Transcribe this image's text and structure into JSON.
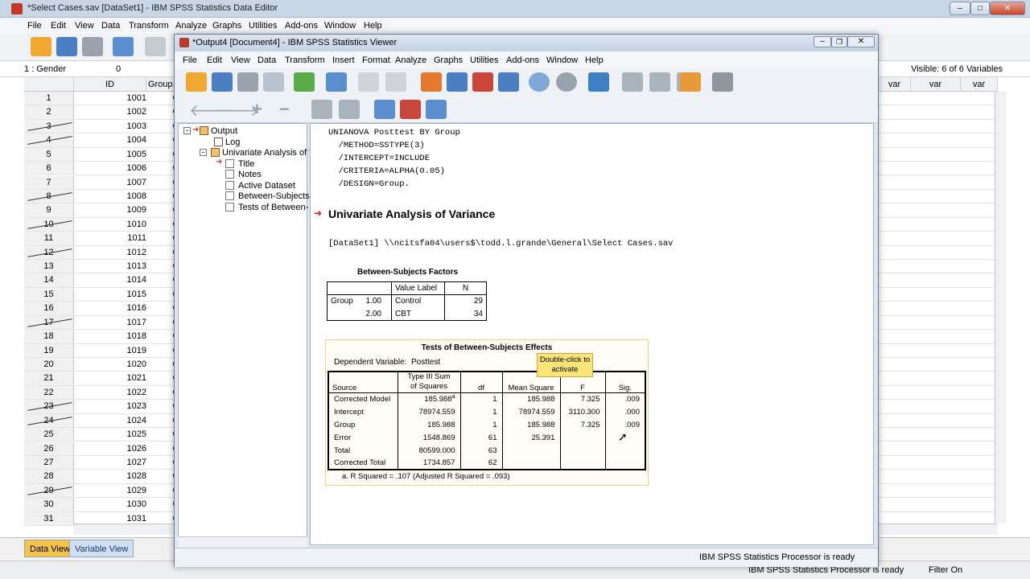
{
  "data_editor": {
    "title": "*Select Cases.sav [DataSet1] - IBM SPSS Statistics Data Editor",
    "menu": [
      "File",
      "Edit",
      "View",
      "Data",
      "Transform",
      "Analyze",
      "Graphs",
      "Utilities",
      "Add-ons",
      "Window",
      "Help"
    ],
    "cell_ref": "1 : Gender",
    "cell_value": "0",
    "visible_vars": "Visible: 6 of 6 Variables",
    "columns": [
      "ID",
      "Group",
      "var",
      "var",
      "var"
    ],
    "rows": [
      {
        "n": "1",
        "id": "1001",
        "group": "Control"
      },
      {
        "n": "2",
        "id": "1002",
        "group": "Control"
      },
      {
        "n": "3",
        "id": "1003",
        "group": "Control"
      },
      {
        "n": "4",
        "id": "1004",
        "group": "Control"
      },
      {
        "n": "5",
        "id": "1005",
        "group": "Control"
      },
      {
        "n": "6",
        "id": "1006",
        "group": "Control"
      },
      {
        "n": "7",
        "id": "1007",
        "group": "Control"
      },
      {
        "n": "8",
        "id": "1008",
        "group": "Control"
      },
      {
        "n": "9",
        "id": "1009",
        "group": "Control"
      },
      {
        "n": "10",
        "id": "1010",
        "group": "Control"
      },
      {
        "n": "11",
        "id": "1011",
        "group": "Control"
      },
      {
        "n": "12",
        "id": "1012",
        "group": "Control"
      },
      {
        "n": "13",
        "id": "1013",
        "group": "Control"
      },
      {
        "n": "14",
        "id": "1014",
        "group": "Control"
      },
      {
        "n": "15",
        "id": "1015",
        "group": "Control"
      },
      {
        "n": "16",
        "id": "1016",
        "group": "Control"
      },
      {
        "n": "17",
        "id": "1017",
        "group": "Control"
      },
      {
        "n": "18",
        "id": "1018",
        "group": "Control"
      },
      {
        "n": "19",
        "id": "1019",
        "group": "Control"
      },
      {
        "n": "20",
        "id": "1020",
        "group": "Control"
      },
      {
        "n": "21",
        "id": "1021",
        "group": "Control"
      },
      {
        "n": "22",
        "id": "1022",
        "group": "Control"
      },
      {
        "n": "23",
        "id": "1023",
        "group": "Control"
      },
      {
        "n": "24",
        "id": "1024",
        "group": "Control"
      },
      {
        "n": "25",
        "id": "1025",
        "group": "Control"
      },
      {
        "n": "26",
        "id": "1026",
        "group": "Control"
      },
      {
        "n": "27",
        "id": "1027",
        "group": "Control"
      },
      {
        "n": "28",
        "id": "1028",
        "group": "Control"
      },
      {
        "n": "29",
        "id": "1029",
        "group": "Control"
      },
      {
        "n": "30",
        "id": "1030",
        "group": "Control"
      },
      {
        "n": "31",
        "id": "1031",
        "group": "Control"
      }
    ],
    "tabs": {
      "data_view": "Data View",
      "variable_view": "Variable View"
    },
    "status": {
      "processor": "IBM SPSS Statistics Processor is ready",
      "filter": "Filter On"
    }
  },
  "viewer": {
    "title": "*Output4 [Document4] - IBM SPSS Statistics Viewer",
    "menu": [
      "File",
      "Edit",
      "View",
      "Data",
      "Transform",
      "Insert",
      "Format",
      "Analyze",
      "Graphs",
      "Utilities",
      "Add-ons",
      "Window",
      "Help"
    ],
    "outline": {
      "root": "Output",
      "log": "Log",
      "analysis": "Univariate Analysis of V",
      "items": [
        "Title",
        "Notes",
        "Active Dataset",
        "Between-Subjects",
        "Tests of Between-"
      ]
    },
    "syntax": [
      "UNIANOVA Posttest BY Group",
      "  /METHOD=SSTYPE(3)",
      "  /INTERCEPT=INCLUDE",
      "  /CRITERIA=ALPHA(0.05)",
      "  /DESIGN=Group."
    ],
    "heading": "Univariate Analysis of Variance",
    "dataset_line": "[DataSet1] \\\\ncitsfa04\\users$\\todd.l.grande\\General\\Select Cases.sav",
    "bsf": {
      "title": "Between-Subjects Factors",
      "col_value": "Value Label",
      "col_n": "N",
      "group": "Group",
      "rows": [
        {
          "code": "1.00",
          "label": "Control",
          "n": "29"
        },
        {
          "code": "2.00",
          "label": "CBT",
          "n": "34"
        }
      ]
    },
    "tbse": {
      "title": "Tests of Between-Subjects Effects",
      "dep": "Dependent Variable:",
      "dep_value": "Posttest",
      "tooltip": "Double-click to activate",
      "headers": {
        "source": "Source",
        "ss_line1": "Type III Sum",
        "ss_line2": "of Squares",
        "df": "df",
        "ms": "Mean Square",
        "f": "F",
        "sig": "Sig."
      },
      "rows": [
        {
          "source": "Corrected Model",
          "ss": "185.988",
          "sup": "a",
          "df": "1",
          "ms": "185.988",
          "f": "7.325",
          "sig": ".009"
        },
        {
          "source": "Intercept",
          "ss": "78974.559",
          "sup": "",
          "df": "1",
          "ms": "78974.559",
          "f": "3110.300",
          "sig": ".000"
        },
        {
          "source": "Group",
          "ss": "185.988",
          "sup": "",
          "df": "1",
          "ms": "185.988",
          "f": "7.325",
          "sig": ".009"
        },
        {
          "source": "Error",
          "ss": "1548.869",
          "sup": "",
          "df": "61",
          "ms": "25.391",
          "f": "",
          "sig": ""
        },
        {
          "source": "Total",
          "ss": "80599.000",
          "sup": "",
          "df": "63",
          "ms": "",
          "f": "",
          "sig": ""
        },
        {
          "source": "Corrected Total",
          "ss": "1734.857",
          "sup": "",
          "df": "62",
          "ms": "",
          "f": "",
          "sig": ""
        }
      ],
      "footnote": "a. R Squared = .107 (Adjusted R Squared = .093)"
    },
    "status": "IBM SPSS Statistics Processor is ready"
  }
}
